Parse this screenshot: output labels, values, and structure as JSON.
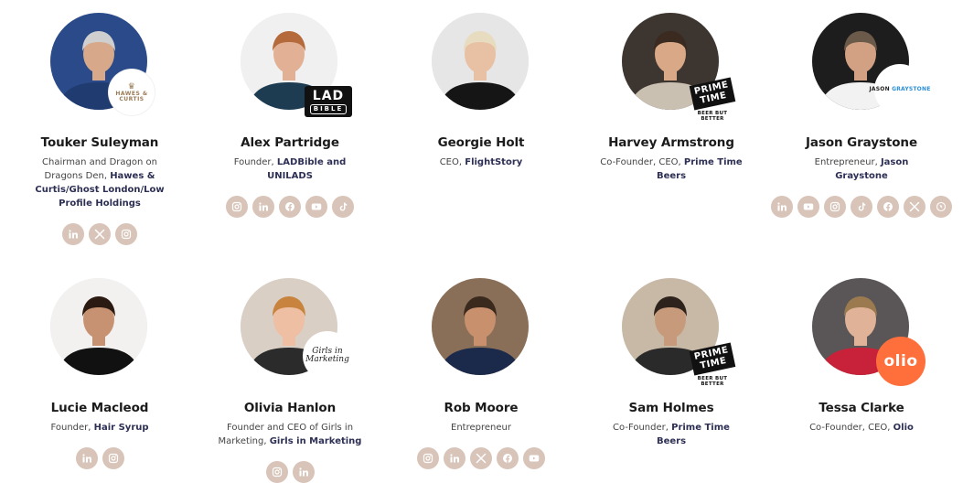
{
  "people": [
    {
      "name": "Touker Suleyman",
      "role_plain": "Chairman and Dragon on Dragons Den, ",
      "role_bold": "Hawes & Curtis/Ghost London/Low Profile Holdings",
      "badge": "circle",
      "badge_text": "HAWES & CURTIS",
      "socials": [
        "linkedin-icon",
        "x-icon",
        "instagram-icon"
      ]
    },
    {
      "name": "Alex Partridge",
      "role_plain": "Founder, ",
      "role_bold": "LADBible and UNILADS",
      "badge": "lad",
      "badge_text": "LAD",
      "badge_sub": "BIBLE",
      "socials": [
        "instagram-icon",
        "linkedin-icon",
        "facebook-icon",
        "youtube-icon",
        "tiktok-icon"
      ]
    },
    {
      "name": "Georgie Holt",
      "role_plain": "CEO, ",
      "role_bold": "FlightStory",
      "badge": "none",
      "socials": []
    },
    {
      "name": "Harvey Armstrong",
      "role_plain": "Co-Founder, CEO, ",
      "role_bold": "Prime Time Beers",
      "badge": "prime",
      "badge_text": "PRIME TIME",
      "badge_sub": "BEER BUT BETTER",
      "socials": []
    },
    {
      "name": "Jason Graystone",
      "role_plain": "Entrepreneur, ",
      "role_bold": "Jason Graystone",
      "badge": "graystone",
      "badge_text": "JASON",
      "badge_sub": "GRAYSTONE",
      "socials": [
        "linkedin-icon",
        "youtube-icon",
        "instagram-icon",
        "tiktok-icon",
        "facebook-icon",
        "x-icon",
        "website-icon"
      ]
    },
    {
      "name": "Lucie Macleod",
      "role_plain": "Founder, ",
      "role_bold": "Hair Syrup",
      "badge": "none",
      "socials": [
        "linkedin-icon",
        "instagram-icon"
      ]
    },
    {
      "name": "Olivia Hanlon",
      "role_plain": "Founder and CEO of Girls in Marketing, ",
      "role_bold": "Girls in Marketing",
      "badge": "girls",
      "badge_text": "Girls in",
      "badge_sub": "Marketing",
      "socials": [
        "instagram-icon",
        "linkedin-icon"
      ]
    },
    {
      "name": "Rob Moore",
      "role_plain": "Entrepreneur",
      "role_bold": "",
      "badge": "none",
      "socials": [
        "instagram-icon",
        "linkedin-icon",
        "x-icon",
        "facebook-icon",
        "youtube-icon"
      ]
    },
    {
      "name": "Sam Holmes",
      "role_plain": "Co-Founder, ",
      "role_bold": "Prime Time Beers",
      "badge": "prime",
      "badge_text": "PRIME TIME",
      "badge_sub": "BEER BUT BETTER",
      "socials": []
    },
    {
      "name": "Tessa Clarke",
      "role_plain": "Co-Founder, CEO, ",
      "role_bold": "Olio",
      "badge": "olio",
      "badge_text": "olio",
      "socials": []
    }
  ],
  "colors": {
    "social_bg": "#d8c4b8",
    "name": "#1b1b1b",
    "highlight": "#2d2f54"
  }
}
